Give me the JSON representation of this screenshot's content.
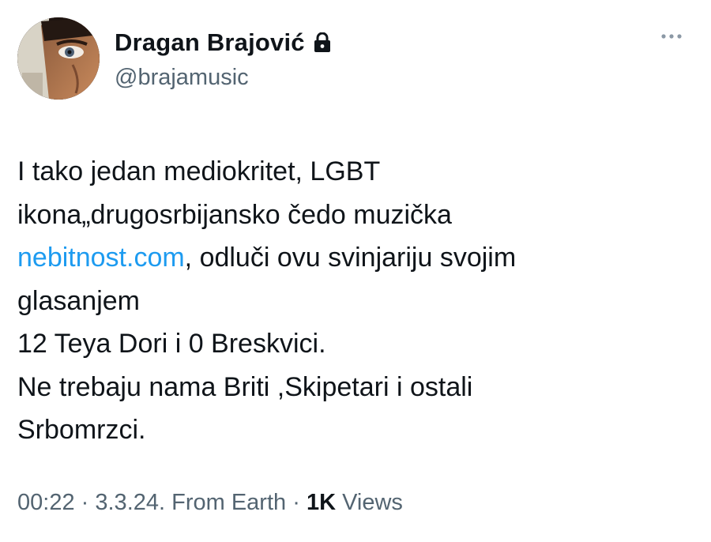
{
  "author": {
    "display_name": "Dragan Brajović",
    "handle": "@brajamusic",
    "protected_icon": "lock-icon",
    "avatar": "profile-photo"
  },
  "menu": {
    "icon": "more-dots-icon"
  },
  "tweet": {
    "lines": [
      "I tako jedan mediokritet, LGBT",
      "ikona„drugosrbijansko čedo muzička",
      "glasanjem",
      "12 Teya Dori i 0 Breskvici.",
      "Ne trebaju nama Briti ,Skipetari i ostali",
      "Srbomrzci."
    ],
    "link_text": "nebitnost.com",
    "link_line_rest": ", odluči ovu svinjariju svojim"
  },
  "meta": {
    "time": "00:22",
    "date": "3.3.24.",
    "source": "From Earth",
    "separator": "·",
    "views_count": "1K",
    "views_label": "Views"
  },
  "colors": {
    "text": "#0f1419",
    "secondary": "#536471",
    "link": "#1d9bf0"
  }
}
